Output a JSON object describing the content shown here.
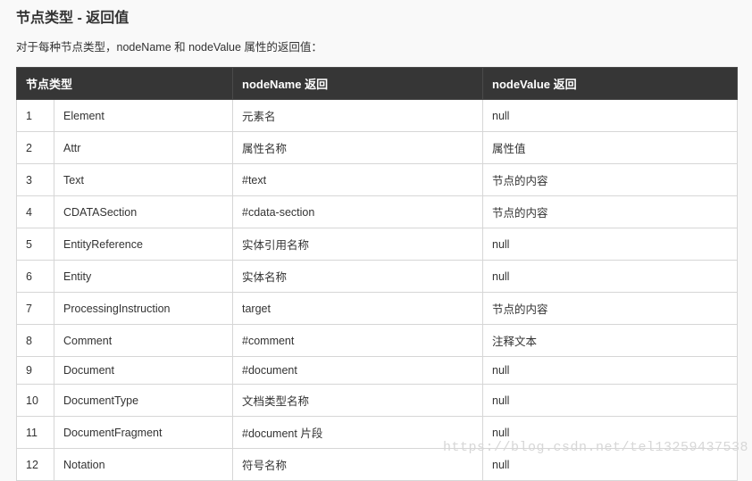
{
  "heading": "节点类型 - 返回值",
  "description": "对于每种节点类型，nodeName 和 nodeValue 属性的返回值：",
  "table": {
    "headers": [
      "节点类型",
      "nodeName 返回",
      "nodeValue 返回"
    ],
    "rows": [
      {
        "n": "1",
        "type": "Element",
        "nodeName": "元素名",
        "nodeValue": "null"
      },
      {
        "n": "2",
        "type": "Attr",
        "nodeName": "属性名称",
        "nodeValue": "属性值"
      },
      {
        "n": "3",
        "type": "Text",
        "nodeName": "#text",
        "nodeValue": "节点的内容"
      },
      {
        "n": "4",
        "type": "CDATASection",
        "nodeName": "#cdata-section",
        "nodeValue": "节点的内容"
      },
      {
        "n": "5",
        "type": "EntityReference",
        "nodeName": "实体引用名称",
        "nodeValue": "null"
      },
      {
        "n": "6",
        "type": "Entity",
        "nodeName": "实体名称",
        "nodeValue": "null"
      },
      {
        "n": "7",
        "type": "ProcessingInstruction",
        "nodeName": "target",
        "nodeValue": "节点的内容"
      },
      {
        "n": "8",
        "type": "Comment",
        "nodeName": "#comment",
        "nodeValue": "注释文本"
      },
      {
        "n": "9",
        "type": "Document",
        "nodeName": "#document",
        "nodeValue": "null"
      },
      {
        "n": "10",
        "type": "DocumentType",
        "nodeName": "文档类型名称",
        "nodeValue": "null"
      },
      {
        "n": "11",
        "type": "DocumentFragment",
        "nodeName": "#document 片段",
        "nodeValue": "null"
      },
      {
        "n": "12",
        "type": "Notation",
        "nodeName": "符号名称",
        "nodeValue": "null"
      }
    ]
  },
  "watermark": "https://blog.csdn.net/tel13259437538"
}
